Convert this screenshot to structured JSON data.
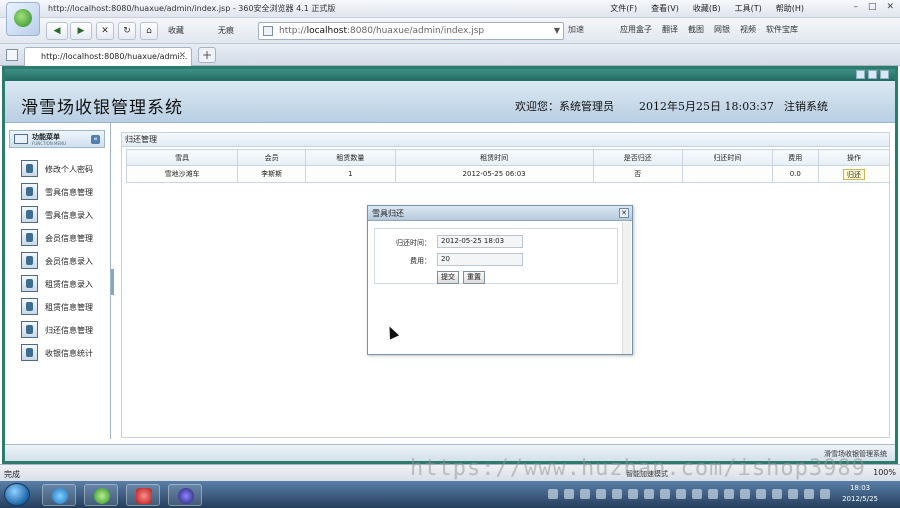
{
  "browser": {
    "window_title": "http://localhost:8080/huaxue/admin/index.jsp - 360安全浏览器 4.1 正式版",
    "menu": [
      "文件(F)",
      "查看(V)",
      "收藏(B)",
      "工具(T)",
      "帮助(H)"
    ],
    "nav": {
      "back_label": "收藏",
      "bookmark_label": "无痕"
    },
    "address": {
      "prefix": "http://",
      "host": "localhost",
      "rest": ":8080/huaxue/admin/index.jsp"
    },
    "go_label": "加速",
    "toolbar_items": [
      "应用盒子",
      "翻译",
      "截图",
      "网银",
      "视频",
      "软件宝库"
    ],
    "tab": {
      "label": "http://localhost:8080/huaxue/admi..."
    },
    "status": {
      "text": "完成",
      "mode": "智能加速模式",
      "zoom": "100%"
    }
  },
  "header": {
    "title": "滑雪场收银管理系统",
    "welcome": "欢迎您：系统管理员",
    "datetime": "2012年5月25日  18:03:37",
    "logout": "注销系统"
  },
  "sidebar": {
    "head": "功能菜单",
    "head_sub": "FUNCTION MENU",
    "items": [
      "修改个人密码",
      "雪具信息管理",
      "雪具信息录入",
      "会员信息管理",
      "会员信息录入",
      "租赁信息录入",
      "租赁信息管理",
      "归还信息管理",
      "收银信息统计"
    ]
  },
  "main": {
    "panel_title": "归还管理",
    "columns": [
      "雪具",
      "会员",
      "租赁数量",
      "租赁时间",
      "是否归还",
      "归还时间",
      "费用",
      "操作"
    ],
    "rows": [
      {
        "equipment": "雪地沙滩车",
        "member": "李斯斯",
        "quantity": "1",
        "rent_time": "2012-05-25 06:03",
        "returned": "否",
        "return_time": "",
        "fee": "0.0",
        "action": "归还"
      }
    ]
  },
  "dialog": {
    "title": "雪具归还",
    "return_time_label": "归还时间：",
    "return_time_value": "2012-05-25 18:03",
    "fee_label": "费用：",
    "fee_value": "20",
    "submit_label": "提交",
    "reset_label": "重置"
  },
  "footer": {
    "text": "滑雪场收银管理系统"
  },
  "watermark": "https://www.huzhan.com/ishop3989",
  "taskbar": {
    "time": "18:03",
    "date": "2012/5/25"
  }
}
